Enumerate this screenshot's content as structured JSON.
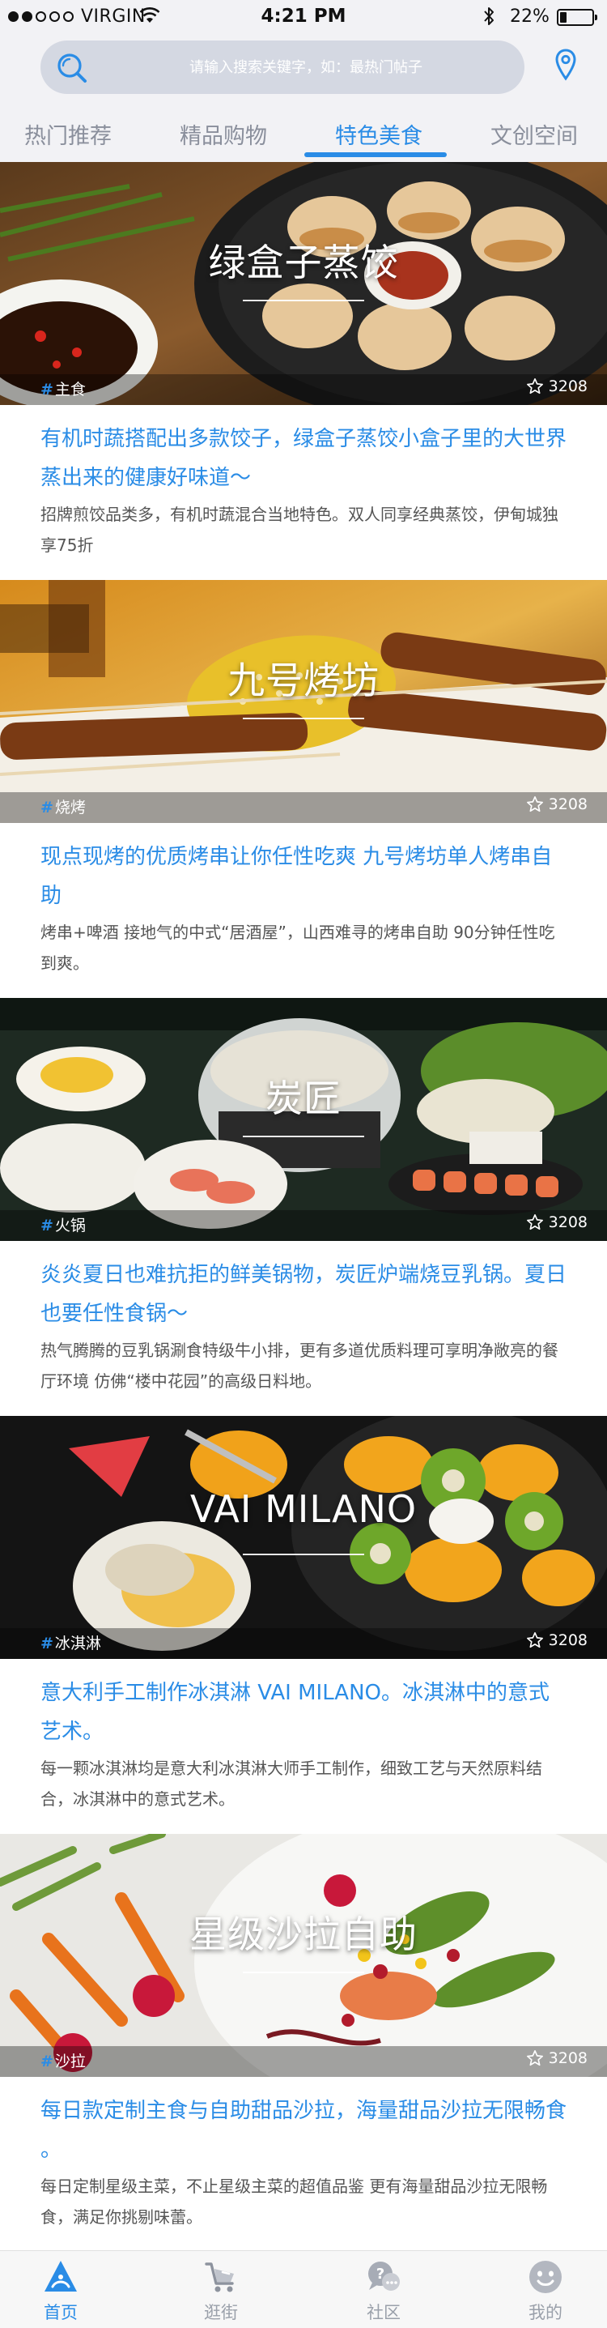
{
  "status_bar": {
    "carrier": "VIRGIN",
    "time": "4:21 PM",
    "battery": "22%",
    "battery_level": 0.22
  },
  "search": {
    "placeholder": "请输入搜索关键字，如：最热门帖子"
  },
  "tabs": [
    {
      "label": "热门推荐",
      "active": false
    },
    {
      "label": "精品购物",
      "active": false
    },
    {
      "label": "特色美食",
      "active": true
    },
    {
      "label": "文创空间",
      "active": false
    }
  ],
  "cards": [
    {
      "hero_title": "绿盒子蒸饺",
      "tag": "主食",
      "likes": "3208",
      "title": "有机时蔬搭配出多款饺子，绿盒子蒸饺小盒子里的大世界 蒸出来的健康好味道～",
      "description": "招牌煎饺品类多，有机时蔬混合当地特色。双人同享经典蒸饺，伊甸城独享75折"
    },
    {
      "hero_title": "九号烤坊",
      "tag": "烧烤",
      "likes": "3208",
      "title": "现点现烤的优质烤串让你任性吃爽 九号烤坊单人烤串自助",
      "description": "烤串+啤酒 接地气的中式“居酒屋”，山西难寻的烤串自助 90分钟任性吃到爽。"
    },
    {
      "hero_title": "炭匠",
      "tag": "火锅",
      "likes": "3208",
      "title": "炎炎夏日也难抗拒的鲜美锅物，炭匠炉端烧豆乳锅。夏日也要任性食锅～",
      "description": "热气腾腾的豆乳锅涮食特级牛小排，更有多道优质料理可享明净敞亮的餐厅环境 仿佛“楼中花园”的高级日料地。"
    },
    {
      "hero_title": "VAI MILANO",
      "tag": "冰淇淋",
      "likes": "3208",
      "title": "意大利手工制作冰淇淋 VAI MILANO。冰淇淋中的意式艺术。",
      "description": "每一颗冰淇淋均是意大利冰淇淋大师手工制作，细致工艺与天然原料结合，冰淇淋中的意式艺术。"
    },
    {
      "hero_title": "星级沙拉自助",
      "tag": "沙拉",
      "likes": "3208",
      "title": "每日款定制主食与自助甜品沙拉，海量甜品沙拉无限畅食 。",
      "description": "每日定制星级主菜，不止星级主菜的超值品鉴 更有海量甜品沙拉无限畅食，满足你挑剔味蕾。"
    }
  ],
  "bottom_nav": [
    {
      "label": "首页",
      "icon": "home-icon",
      "active": true
    },
    {
      "label": "逛街",
      "icon": "shopping-cart-icon",
      "active": false
    },
    {
      "label": "社区",
      "icon": "community-chat-icon",
      "active": false
    },
    {
      "label": "我的",
      "icon": "profile-face-icon",
      "active": false
    }
  ],
  "colors": {
    "accent": "#2a8ce6",
    "header_bg": "#f2f2f5",
    "search_bg": "#d4d8e2",
    "inactive_text": "#8a8f9c"
  }
}
